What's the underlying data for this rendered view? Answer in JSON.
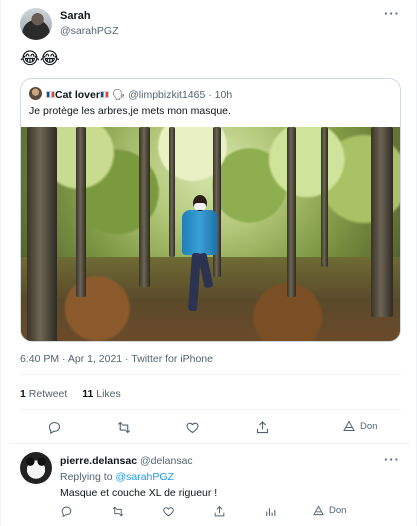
{
  "tweet": {
    "author_name": "Sarah",
    "author_handle": "@sarahPGZ",
    "more_label": "···",
    "text": "😂😂",
    "timestamp": "6:40 PM · Apr 1, 2021 · Twitter for iPhone",
    "stats": {
      "retweets_count": "1",
      "retweets_label": "Retweet",
      "likes_count": "11",
      "likes_label": "Likes"
    },
    "actions": {
      "reply_icon": "reply-icon",
      "retweet_icon": "retweet-icon",
      "like_icon": "heart-icon",
      "share_icon": "share-icon",
      "tip_icon": "tip-icon",
      "tip_label": "Don"
    }
  },
  "quoted": {
    "author_name": "Cat lover",
    "author_handle": "@limpbizkit1465",
    "separator": " · ",
    "time": "10h",
    "text": "Je protège les arbres,je mets mon masque.",
    "media_description_icon": "photo"
  },
  "reply": {
    "author_name": "pierre.delansac",
    "author_handle": "@delansac",
    "more_label": "···",
    "replying_prefix": "Replying to ",
    "replying_to": "@sarahPGZ",
    "text": "Masque et couche XL de rigueur !",
    "actions": {
      "tip_label": "Don"
    }
  },
  "colors": {
    "text_primary": "#0f1419",
    "text_secondary": "#536471",
    "link": "#1d9bf0",
    "border": "#cfd9de"
  }
}
